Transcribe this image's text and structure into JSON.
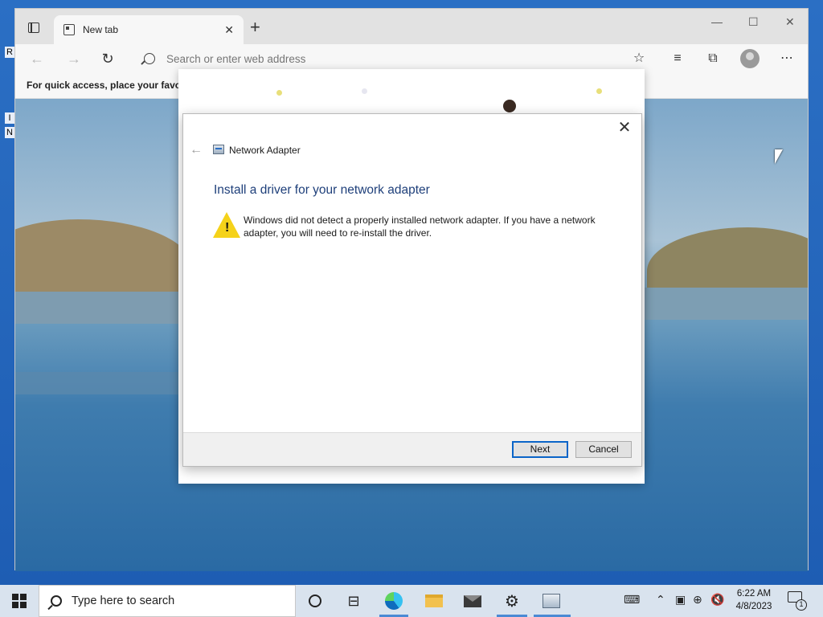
{
  "browser": {
    "tab_title": "New tab",
    "address_placeholder": "Search or enter web address",
    "favorites_hint": "For quick access, place your favorit"
  },
  "dialog": {
    "app_title": "Network Adapter",
    "heading": "Install a driver for your network adapter",
    "message": "Windows did not detect a properly installed network adapter. If you have a network adapter, you will need to re-install the driver.",
    "next_label": "Next",
    "cancel_label": "Cancel",
    "close_glyph": "✕",
    "back_glyph": "←",
    "warning_glyph": "!"
  },
  "desktop": {
    "icon_letters": [
      "R",
      "I",
      "N"
    ]
  },
  "taskbar": {
    "search_placeholder": "Type here to search",
    "time": "6:22 AM",
    "date": "4/8/2023",
    "notification_count": "1"
  }
}
